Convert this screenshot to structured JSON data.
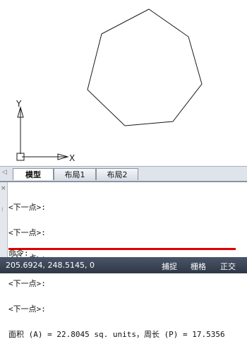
{
  "canvas": {
    "axis_y_label": "Y",
    "axis_x_label": "X",
    "line_color": "#1a1a1a",
    "axis_color": "#1a1a1a"
  },
  "tabs": {
    "model": "模型",
    "layout1": "布局1",
    "layout2": "布局2"
  },
  "command": {
    "history": [
      "<下一点>:",
      "<下一点>:",
      "<下一点>:",
      "<下一点>:",
      "<下一点>:"
    ],
    "result": "面积 (A) = 22.8045 sq. units，周长 (P) = 17.5356",
    "prompt": "命令:",
    "highlight_color": "#e00000"
  },
  "statusbar": {
    "coordinates": "205.6924, 248.5145, 0",
    "snap": "捕捉",
    "grid": "栅格",
    "ortho": "正交"
  }
}
